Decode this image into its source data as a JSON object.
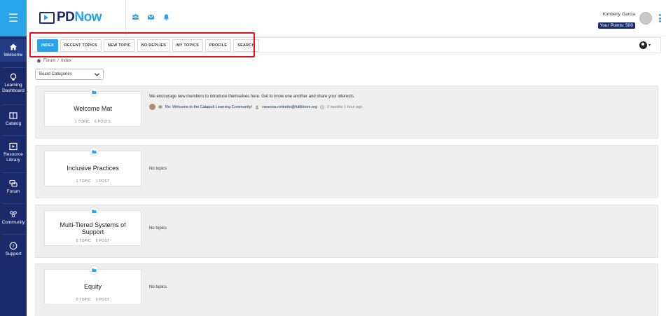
{
  "sidebar": {
    "items": [
      {
        "label_1": "Welcome",
        "label_2": "",
        "icon": "home-icon"
      },
      {
        "label_1": "Learning",
        "label_2": "Dashboard",
        "icon": "lightbulb-icon"
      },
      {
        "label_1": "Catalog",
        "label_2": "",
        "icon": "book-icon"
      },
      {
        "label_1": "Resource",
        "label_2": "Library",
        "icon": "library-icon"
      },
      {
        "label_1": "Forum",
        "label_2": "",
        "icon": "chat-icon"
      },
      {
        "label_1": "Community",
        "label_2": "",
        "icon": "people-icon"
      },
      {
        "label_1": "Support",
        "label_2": "",
        "icon": "help-icon"
      }
    ]
  },
  "header": {
    "logo_pd": "PD",
    "logo_now": "Now",
    "user_name": "Kimberly Garcia",
    "points": "Your Points: 500"
  },
  "forum_nav": {
    "tabs": [
      "INDEX",
      "RECENT TOPICS",
      "NEW TOPIC",
      "NO REPLIES",
      "MY TOPICS",
      "PROFILE",
      "SEARCH"
    ],
    "active_tab": "INDEX"
  },
  "breadcrumb": {
    "forum": "Forum",
    "sep": "/",
    "index": "Index"
  },
  "board_select": {
    "value": "Board Categories"
  },
  "categories": [
    {
      "title": "Welcome Mat",
      "topics": "1 TOPIC",
      "posts": "6 POSTS",
      "description": "We encourage new members to introduce themselves here. Get to know one another and share your interests.",
      "last_topic": "Re: Welcome to the Catapult Learning Community!",
      "last_author": "vanessa.ronketto@fullbloom.org",
      "last_time": "2 months 1 hour ago"
    },
    {
      "title": "Inclusive Practices",
      "topics": "1 TOPIC",
      "posts": "1 POST",
      "description": "No topics"
    },
    {
      "title": "Multi-Tiered Systems of Support",
      "topics": "0 TOPIC",
      "posts": "0 POST",
      "description": "No topics"
    },
    {
      "title": "Equity",
      "topics": "0 TOPIC",
      "posts": "0 POST",
      "description": "No topics"
    }
  ],
  "colors": {
    "sidebar": "#1b2a6b",
    "accent": "#2aa4e8",
    "highlight": "#e0101e"
  }
}
